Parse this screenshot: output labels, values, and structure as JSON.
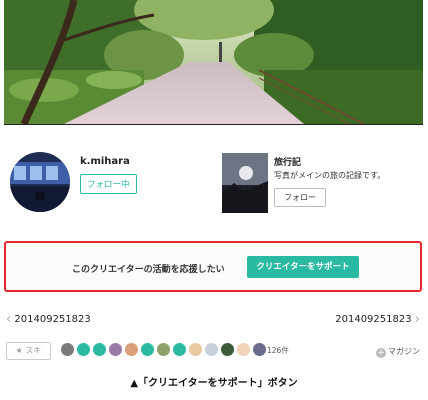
{
  "profile": {
    "name": "k.mihara",
    "follow_label": "フォロー中"
  },
  "magazine": {
    "title": "旅行記",
    "description": "写真がメインの旅の記録です。",
    "follow_label": "フォロー"
  },
  "support": {
    "text": "このクリエイターの活動を応援したい",
    "button_label": "クリエイターをサポート",
    "border_color": "#e8272c",
    "button_color": "#2ab9a3"
  },
  "nav": {
    "prev_label": "201409251823",
    "next_label": "201409251823"
  },
  "reactions": {
    "like_label": "スキ",
    "like_count": "126件",
    "magazine_add_label": "マガジン"
  },
  "caption": "▲「クリエイターをサポート」ボタン"
}
